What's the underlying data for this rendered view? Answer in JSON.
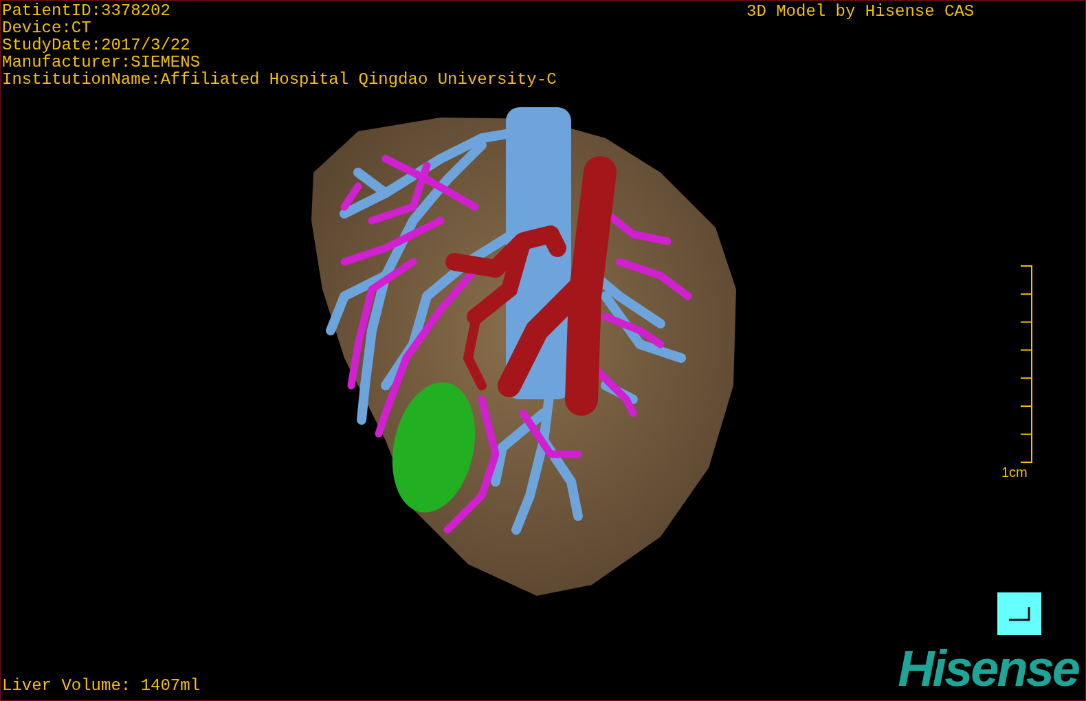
{
  "info_lines": [
    "PatientID:3378202",
    "Device:CT",
    "StudyDate:2017/3/22",
    "Manufacturer:SIEMENS",
    "InstitutionName:Affiliated Hospital Qingdao University-C"
  ],
  "credit": "3D Model by Hisense CAS",
  "scale_bar": {
    "label": "1cm"
  },
  "liver_volume": "Liver Volume: 1407ml",
  "logo": "Hisense"
}
